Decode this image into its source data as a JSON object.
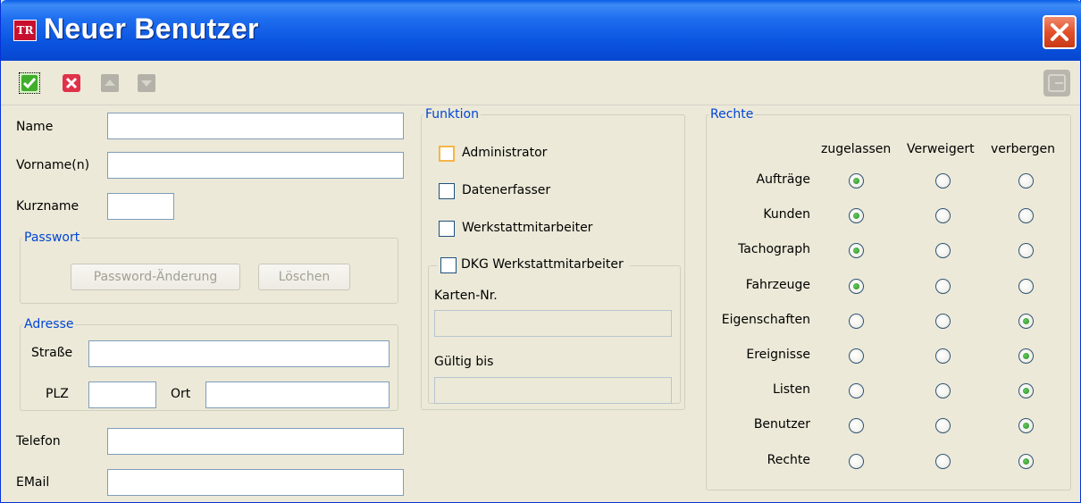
{
  "window": {
    "title": "Neuer Benutzer",
    "app_icon_text": "TR"
  },
  "toolbar": {
    "buttons": [
      "ok",
      "cancel",
      "move-up",
      "move-down",
      "exit"
    ]
  },
  "form": {
    "name_label": "Name",
    "name_value": "",
    "vorname_label": "Vorname(n)",
    "vorname_value": "",
    "kurzname_label": "Kurzname",
    "kurzname_value": "",
    "telefon_label": "Telefon",
    "telefon_value": "",
    "email_label": "EMail",
    "email_value": ""
  },
  "passwort": {
    "legend": "Passwort",
    "change_button": "Password-Änderung",
    "delete_button": "Löschen"
  },
  "adresse": {
    "legend": "Adresse",
    "strasse_label": "Straße",
    "strasse_value": "",
    "plz_label": "PLZ",
    "plz_value": "",
    "ort_label": "Ort",
    "ort_value": ""
  },
  "funktion": {
    "legend": "Funktion",
    "options": [
      {
        "label": "Administrator",
        "checked": false
      },
      {
        "label": "Datenerfasser",
        "checked": false
      },
      {
        "label": "Werkstattmitarbeiter",
        "checked": false
      }
    ],
    "dkg": {
      "label": "DKG Werkstattmitarbeiter",
      "checked": false,
      "karten_label": "Karten-Nr.",
      "karten_value": "",
      "gueltig_label": "Gültig bis",
      "gueltig_value": ""
    }
  },
  "rechte": {
    "legend": "Rechte",
    "columns": [
      "zugelassen",
      "Verweigert",
      "verbergen"
    ],
    "rows": [
      {
        "label": "Aufträge",
        "selected": "zugelassen"
      },
      {
        "label": "Kunden",
        "selected": "zugelassen"
      },
      {
        "label": "Tachograph",
        "selected": "zugelassen"
      },
      {
        "label": "Fahrzeuge",
        "selected": "zugelassen"
      },
      {
        "label": "Eigenschaften",
        "selected": "verbergen"
      },
      {
        "label": "Ereignisse",
        "selected": "verbergen"
      },
      {
        "label": "Listen",
        "selected": "verbergen"
      },
      {
        "label": "Benutzer",
        "selected": "verbergen"
      },
      {
        "label": "Rechte",
        "selected": "verbergen"
      }
    ]
  }
}
